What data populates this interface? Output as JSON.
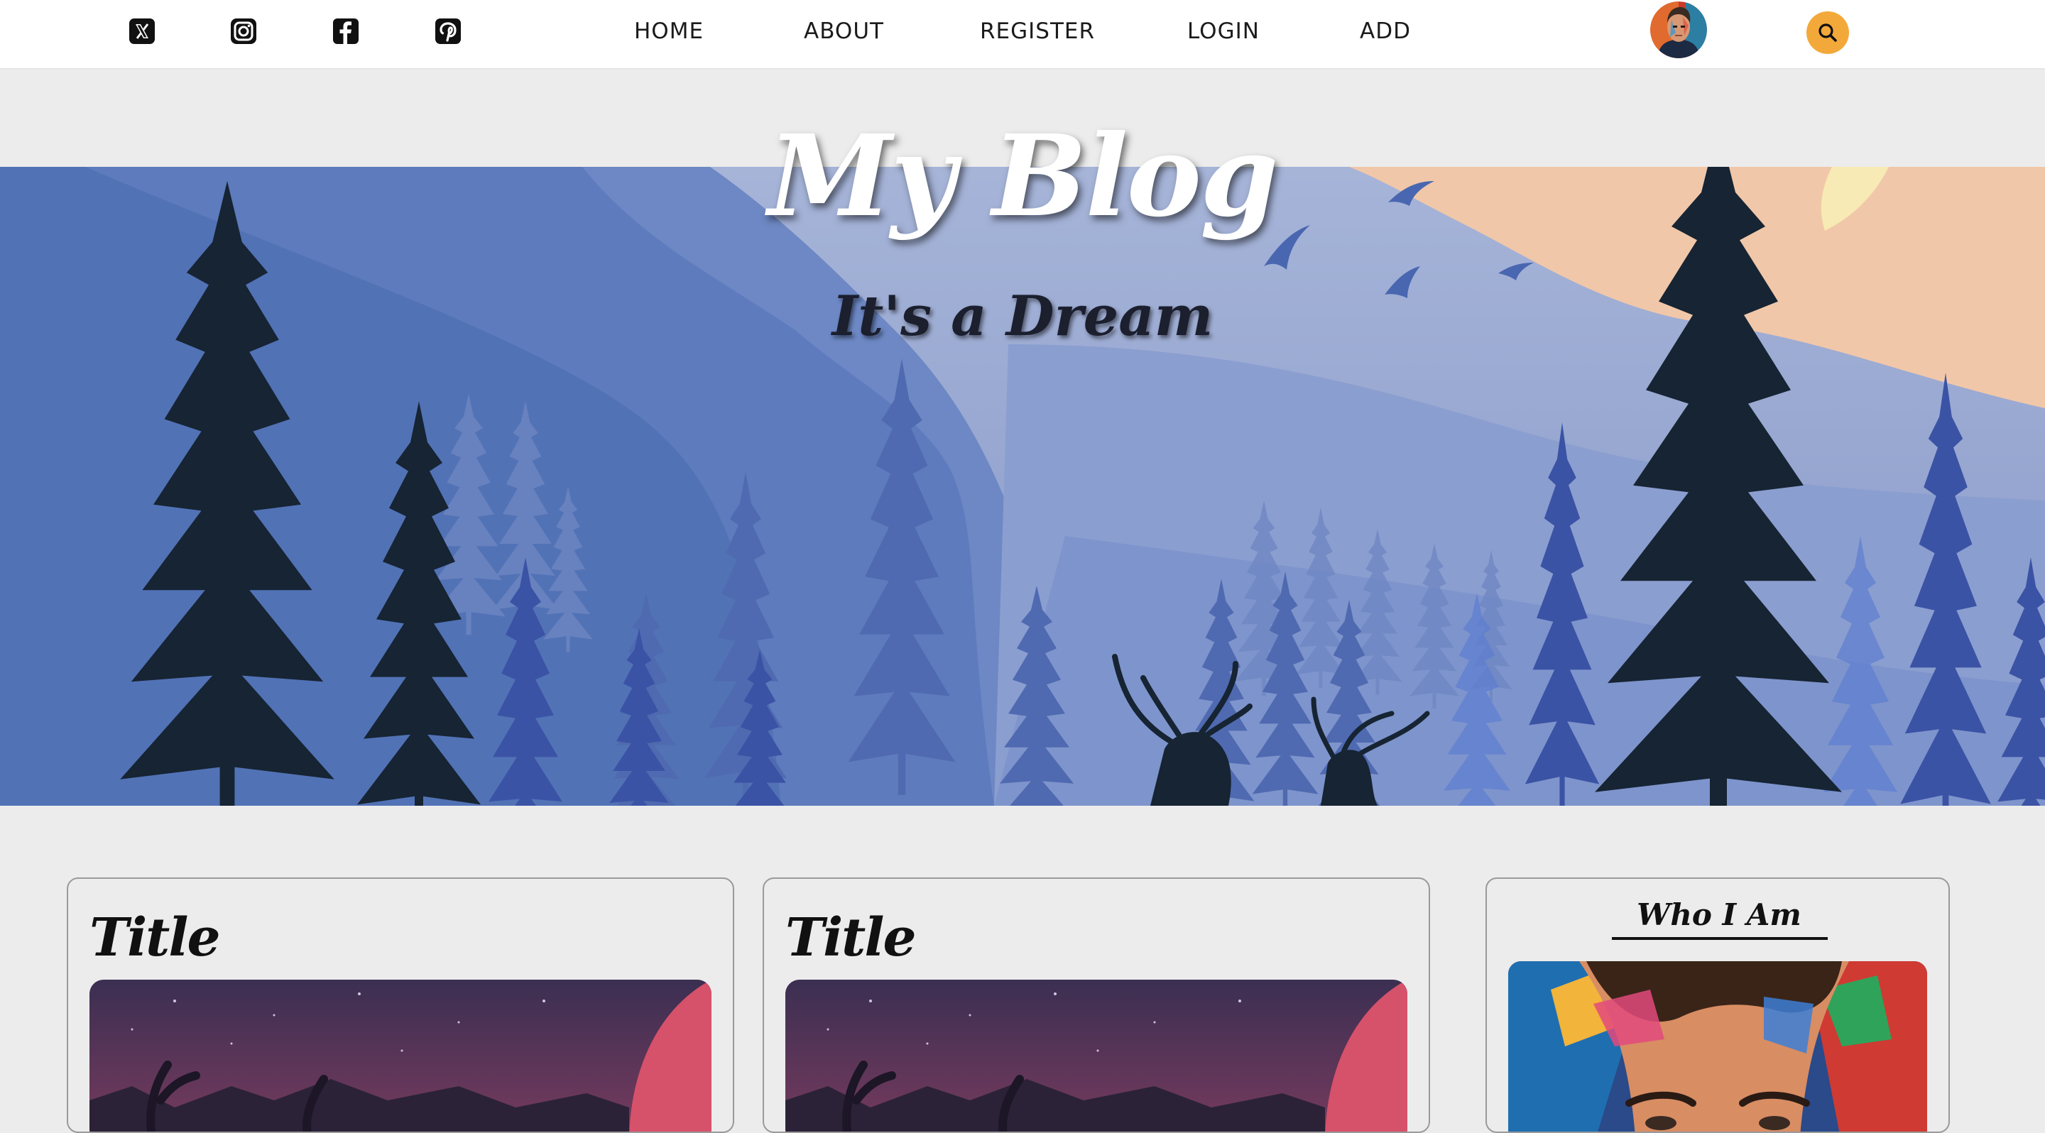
{
  "navbar": {
    "social": [
      {
        "icon": "x-icon"
      },
      {
        "icon": "instagram-icon"
      },
      {
        "icon": "facebook-icon"
      },
      {
        "icon": "pinterest-icon"
      }
    ],
    "links": {
      "home": "HOME",
      "about": "ABOUT",
      "register": "REGISTER",
      "login": "LOGIN",
      "add": "ADD"
    },
    "avatar_icon": "profile-avatar",
    "search_icon": "search-icon",
    "search_color": "#f3a93a"
  },
  "hero": {
    "title": "My Blog",
    "subtitle": "It's a Dream"
  },
  "posts": [
    {
      "title": "Title"
    },
    {
      "title": "Title"
    }
  ],
  "sidebar": {
    "heading": "Who I Am"
  }
}
